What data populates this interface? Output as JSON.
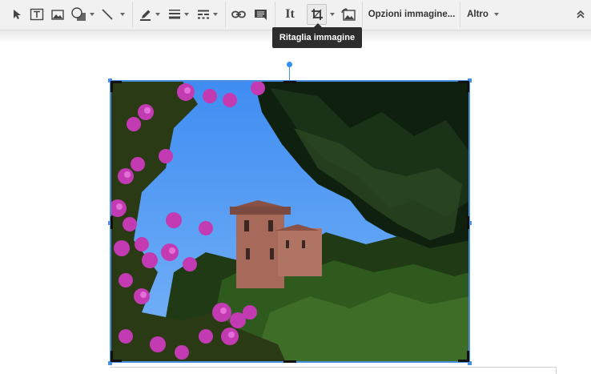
{
  "toolbar": {
    "items": [
      {
        "icon": "select-arrow-icon"
      },
      {
        "icon": "text-box-icon"
      },
      {
        "icon": "image-icon"
      },
      {
        "icon": "shape-icon"
      },
      {
        "icon": "line-icon"
      },
      {
        "icon": "pen-color-icon"
      },
      {
        "icon": "line-weight-icon"
      },
      {
        "icon": "line-dash-icon"
      },
      {
        "icon": "link-icon"
      },
      {
        "icon": "comment-icon"
      },
      {
        "icon": "text-format-icon",
        "label": "It"
      },
      {
        "icon": "crop-icon"
      },
      {
        "icon": "reset-image-icon"
      }
    ],
    "image_options_label": "Opzioni immagine...",
    "more_label": "Altro",
    "collapse_icon": "chevron-up-double-icon"
  },
  "tooltip": {
    "text": "Ritaglia immagine"
  },
  "selection": {
    "accent_color": "#4a90e2"
  }
}
